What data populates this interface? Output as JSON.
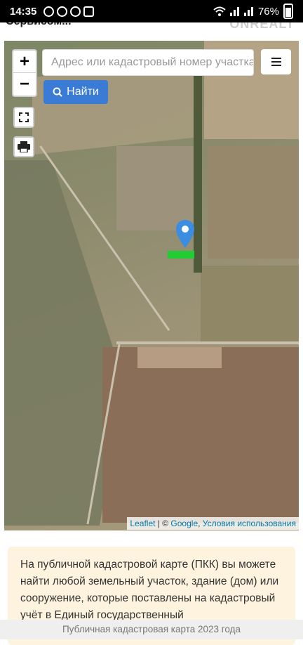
{
  "status_bar": {
    "time": "14:35",
    "battery": "76%",
    "icons": [
      "message-icon",
      "viber-icon",
      "whatsapp-icon",
      "gallery-icon",
      "wifi-icon",
      "signal-icon",
      "signal-icon",
      "battery-icon"
    ]
  },
  "header": {
    "cut_text": "Сервисом...",
    "logo": "ONREALT"
  },
  "map": {
    "zoom_in_label": "+",
    "zoom_out_label": "−",
    "search_placeholder": "Адрес или кадастровый номер участка",
    "find_label": "Найти",
    "menu_icon": "menu-icon",
    "fullscreen_icon": "fullscreen-icon",
    "print_icon": "print-icon",
    "marker_color": "#3a8de0",
    "plot_color": "#22cc33",
    "attribution": {
      "leaflet": "Leaflet",
      "separator": " | © ",
      "google": "Google",
      "comma": ", ",
      "terms": "Условия использования"
    }
  },
  "info": {
    "text": "На публичной кадастровой карте (ПКК) вы можете найти любой земельный участок, здание (дом) или сооружение, которые поставлены на кадастровый учёт в Единый государственный"
  },
  "bottom_bar": {
    "title": "Публичная кадастровая карта 2023 года"
  },
  "colors": {
    "accent": "#3a7bd5",
    "info_bg": "#fdf3df"
  }
}
